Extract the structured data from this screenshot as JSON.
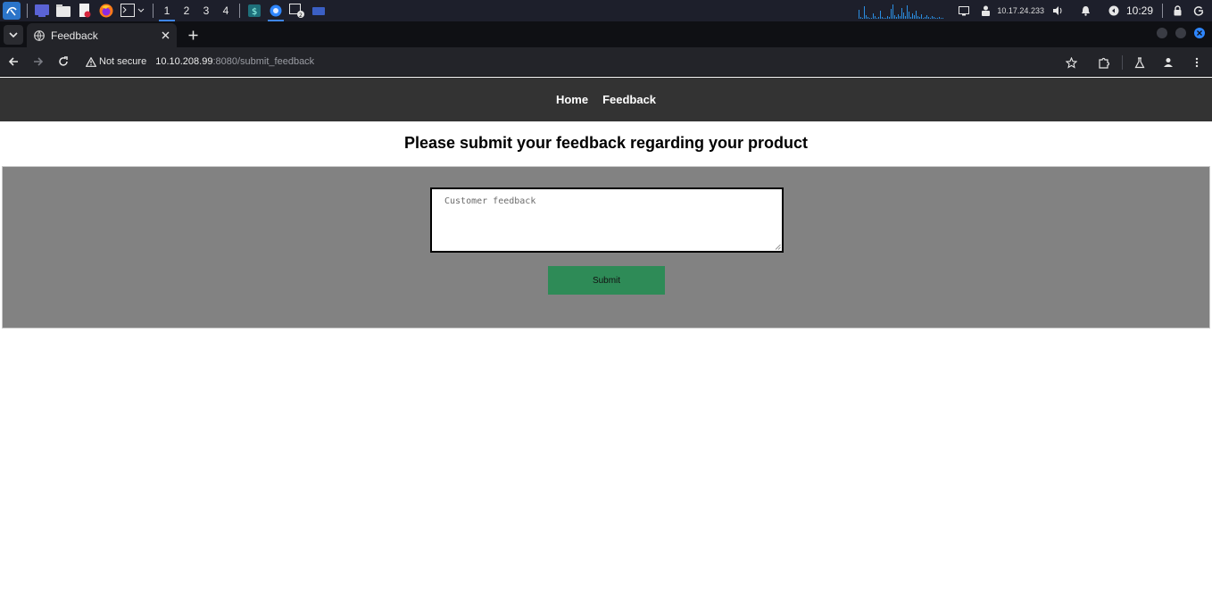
{
  "taskbar": {
    "workspaces": [
      "1",
      "2",
      "3",
      "4"
    ],
    "active_workspace": "1",
    "ip": "10.17.24.233",
    "clock": "10:29",
    "icons": [
      "kali-menu-icon",
      "desktop-icon",
      "file-manager-icon",
      "text-editor-icon",
      "firefox-icon",
      "terminal-icon"
    ]
  },
  "browser": {
    "tab_title": "Feedback",
    "not_secure_label": "Not secure",
    "url_host": "10.10.208.99",
    "url_rest": ":8080/submit_feedback"
  },
  "site": {
    "nav": [
      "Home",
      "Feedback"
    ],
    "heading": "Please submit your feedback regarding your product",
    "feedback_placeholder": "Customer feedback",
    "submit_label": "Submit"
  },
  "colors": {
    "site_nav_bg": "#333333",
    "panel_bg": "#828282",
    "submit_bg": "#2e8b57",
    "accent": "#3f86e8"
  }
}
